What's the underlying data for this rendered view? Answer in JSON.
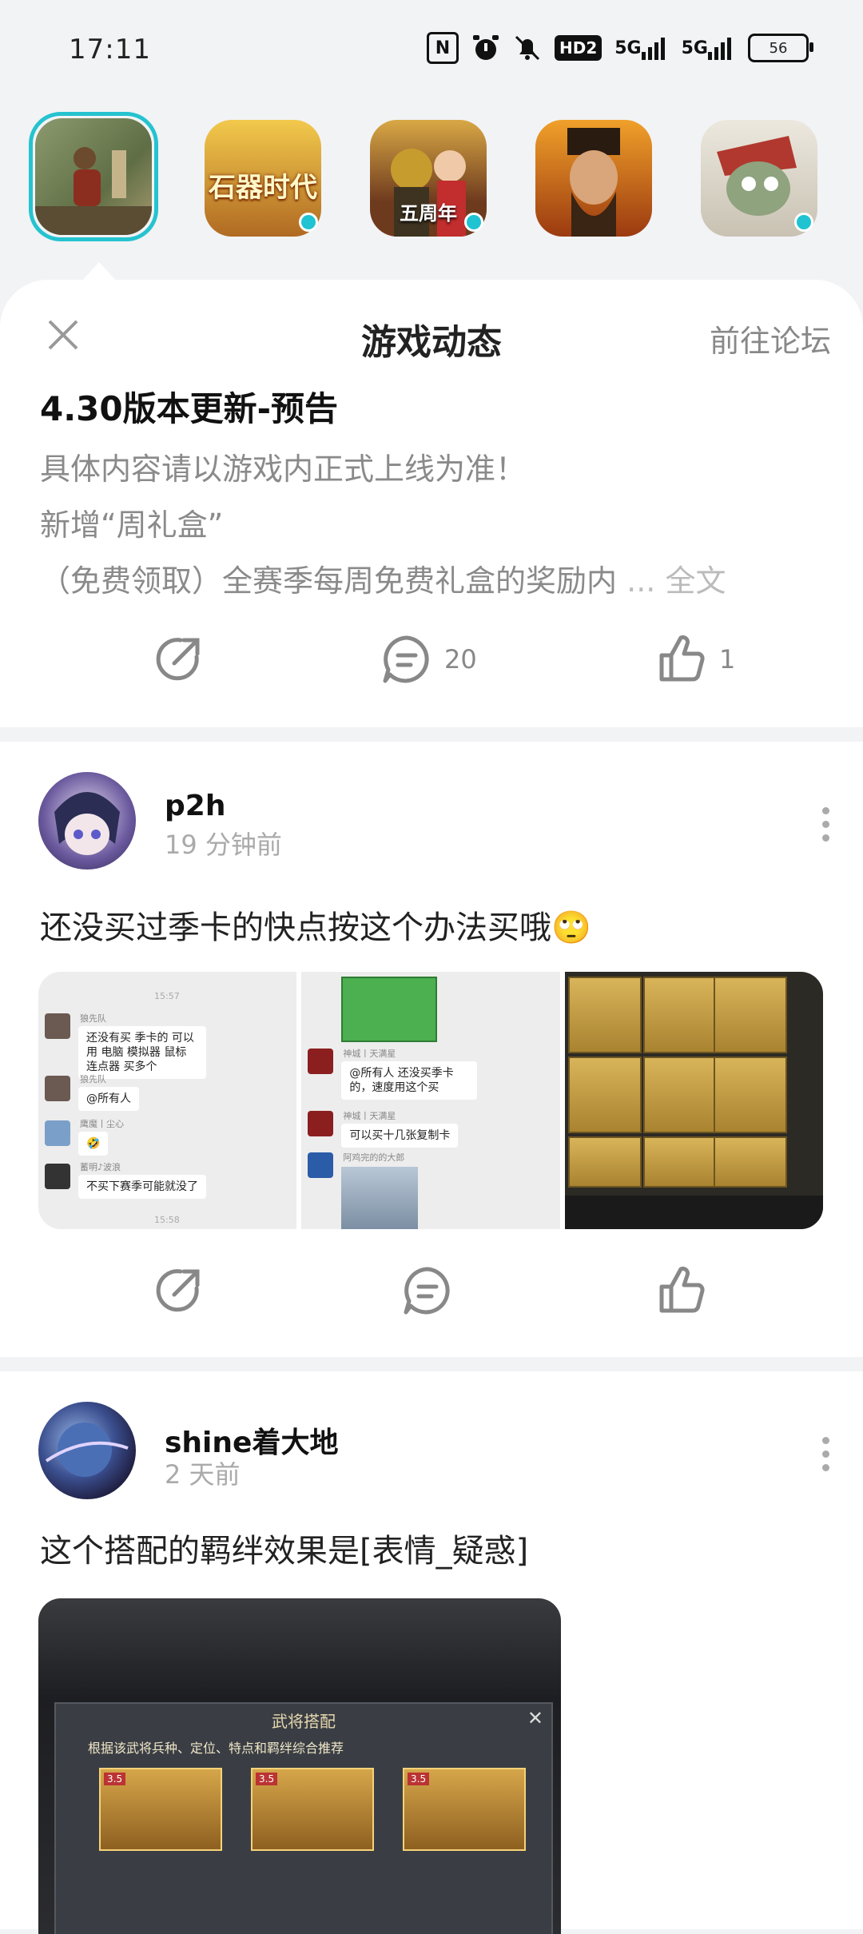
{
  "status": {
    "time": "17:11",
    "network_1": "5G",
    "network_2": "5G",
    "hd": "HD2",
    "battery": "56"
  },
  "games": [
    {
      "name": "selected-game",
      "label": "",
      "colors": [
        "#6d7a55",
        "#a89b6f"
      ]
    },
    {
      "name": "shiqi-shidai",
      "label": "石器时代",
      "colors": [
        "#f5d34a",
        "#8a3f1d"
      ]
    },
    {
      "name": "pubg",
      "label": "五周年",
      "colors": [
        "#e1b844",
        "#6e4b21"
      ]
    },
    {
      "name": "three-kingdoms",
      "label": "",
      "colors": [
        "#d68a1f",
        "#6e2f12"
      ]
    },
    {
      "name": "plants-vs-zombies",
      "label": "",
      "colors": [
        "#e6e3da",
        "#b1382e"
      ]
    }
  ],
  "panel": {
    "title": "游戏动态",
    "forum_link": "前往论坛",
    "news_title": "4.30版本更新-预告",
    "lines": [
      "具体内容请以游戏内正式上线为准！",
      "新增“周礼盒”",
      "（免费领取）全赛季每周免费礼盒的奖励内"
    ],
    "ellipsis": "...",
    "fulltext": "全文",
    "comments": "20",
    "likes": "1"
  },
  "post1": {
    "user": "p2h",
    "time": "19 分钟前",
    "text": "还没买过季卡的快点按这个办法买哦",
    "emoji": "🙄",
    "chat": {
      "time_a": "15:57",
      "time_b": "15:58",
      "n1": "狼先队",
      "m1": "还没有买 季卡的 可以用 电脑 模拟器 鼠标 连点器 买多个",
      "n2": "狼先队",
      "m2": "@所有人",
      "n3": "鹰魔丨尘心",
      "m3": "🤣",
      "n4": "蓄明♪波浪",
      "m4": "不买下赛季可能就没了",
      "n5": "神城丨天满星",
      "m5": "@所有人 还没买季卡的，速度用这个买",
      "n6": "神城丨天满星",
      "m6": "可以买十几张复制卡",
      "n7": "阿鸡完的的大郎"
    }
  },
  "post2": {
    "user": "shine着大地",
    "time": "2 天前",
    "text": "这个搭配的羁绊效果是[表情_疑惑]",
    "img_title": "武将搭配",
    "img_tip": "根据该武将兵种、定位、特点和羁绊综合推荐",
    "badge": "3.5"
  }
}
